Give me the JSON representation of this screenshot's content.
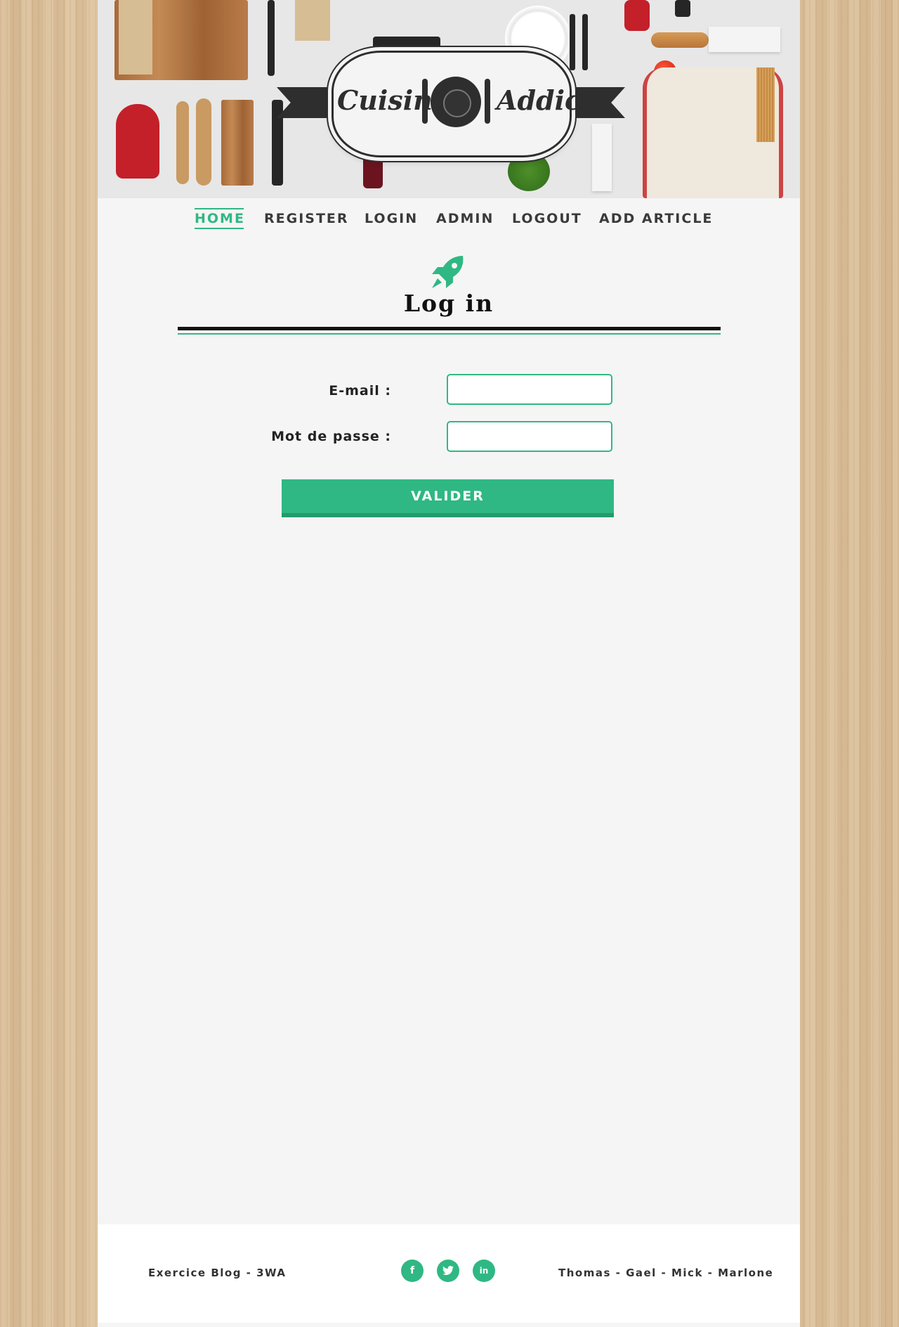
{
  "logo": {
    "left_word": "Cuisine",
    "right_word": "Addict"
  },
  "nav": {
    "items": [
      {
        "label": "HOME",
        "active": true
      },
      {
        "label": "REGISTER",
        "active": false
      },
      {
        "label": "LOGIN",
        "active": false
      },
      {
        "label": "ADMIN",
        "active": false
      },
      {
        "label": "LOGOUT",
        "active": false
      },
      {
        "label": "ADD ARTICLE",
        "active": false
      }
    ]
  },
  "main": {
    "icon": "rocket-icon",
    "title": "Log in"
  },
  "form": {
    "email_label": "E-mail :",
    "email_value": "",
    "password_label": "Mot de passe :",
    "password_value": "",
    "submit_label": "VALIDER"
  },
  "footer": {
    "left_text": "Exercice Blog - 3WA",
    "right_text": "Thomas - Gael - Mick - Marlone",
    "social": [
      {
        "icon": "facebook-icon",
        "glyph": "f"
      },
      {
        "icon": "twitter-icon",
        "glyph": "t"
      },
      {
        "icon": "linkedin-icon",
        "glyph": "in"
      }
    ]
  },
  "colors": {
    "accent": "#2fb883",
    "page_background": "#f5f5f5",
    "text_dark": "#111111"
  }
}
